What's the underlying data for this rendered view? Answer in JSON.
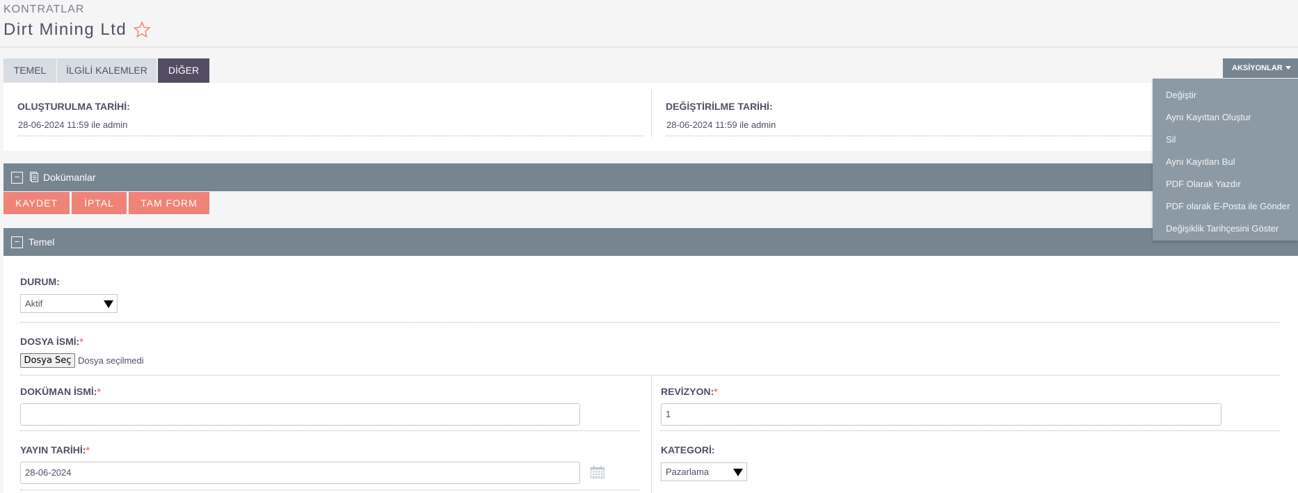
{
  "header": {
    "module": "KONTRATLAR",
    "record_title": "Dirt Mining Ltd"
  },
  "tabs": [
    {
      "label": "TEMEL",
      "active": false
    },
    {
      "label": "İLGİLİ KALEMLER",
      "active": false
    },
    {
      "label": "DİĞER",
      "active": true
    }
  ],
  "actions": {
    "label": "AKSİYONLAR",
    "items": [
      "Değiştir",
      "Aynı Kayıttan Oluştur",
      "Sil",
      "Aynı Kayıtları Bul",
      "PDF Olarak Yazdır",
      "PDF olarak E-Posta ile Gönder",
      "Değişiklik Tarihçesini Göster"
    ]
  },
  "detail": {
    "created_label": "OLUŞTURULMA TARİHİ:",
    "created_value": "28-06-2024 11:59 ile admin",
    "modified_label": "DEĞİŞTİRİLME TARİHİ:",
    "modified_value": "28-06-2024 11:59 ile admin"
  },
  "documents_panel": {
    "title": "Dokümanlar"
  },
  "form_buttons": {
    "save": "KAYDET",
    "cancel": "İPTAL",
    "full_form": "TAM FORM"
  },
  "basic_panel": {
    "title": "Temel"
  },
  "form": {
    "status_label": "DURUM:",
    "status_value": "Aktif",
    "filename_label": "DOSYA İSMİ:",
    "file_button": "Dosya Seç",
    "file_status": "Dosya seçilmedi",
    "docname_label": "DOKÜMAN İSMİ:",
    "docname_value": "",
    "revision_label": "REVİZYON:",
    "revision_value": "1",
    "publish_date_label": "YAYIN TARİHİ:",
    "publish_date_value": "28-06-2024",
    "category_label": "KATEGORİ:",
    "category_value": "Pazarlama",
    "required_mark": "*"
  },
  "colors": {
    "accent": "#f08377",
    "panel_bar": "#778591",
    "active_tab": "#534d64",
    "menu_bg": "#8c9aa5"
  }
}
